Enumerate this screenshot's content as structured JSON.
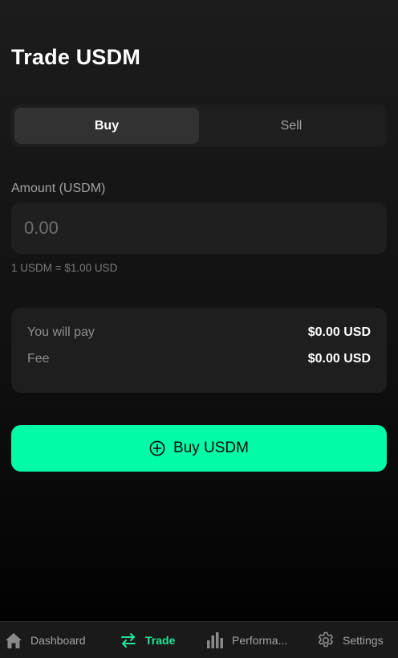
{
  "page": {
    "title": "Trade USDM"
  },
  "toggle": {
    "buy_label": "Buy",
    "sell_label": "Sell",
    "selected": "Buy"
  },
  "amount": {
    "label": "Amount (USDM)",
    "placeholder": "0.00",
    "value": "",
    "rate_text": "1 USDM = $1.00 USD"
  },
  "summary": {
    "pay_label": "You will pay",
    "pay_value": "$0.00 USD",
    "fee_label": "Fee",
    "fee_value": "$0.00 USD"
  },
  "action": {
    "label": "Buy USDM",
    "icon": "plus-circle-icon"
  },
  "nav": {
    "items": [
      {
        "label": "Dashboard",
        "icon": "home-icon",
        "active": false
      },
      {
        "label": "Trade",
        "icon": "swap-arrows-icon",
        "active": true
      },
      {
        "label": "Performa...",
        "icon": "bar-chart-icon",
        "active": false
      },
      {
        "label": "Settings",
        "icon": "gear-icon",
        "active": false
      }
    ]
  },
  "colors": {
    "accent": "#00fca6",
    "nav_active": "#22e59a",
    "card_bg": "#1e1e1e",
    "muted_text": "#a3a3a3"
  }
}
